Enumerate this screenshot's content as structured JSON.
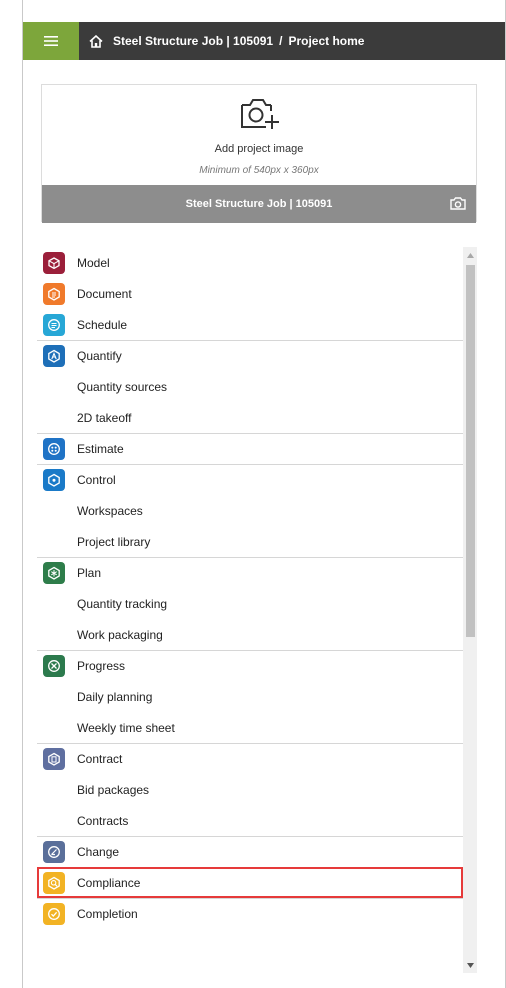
{
  "header": {
    "project": "Steel Structure Job | 105091",
    "separator": "/",
    "page": "Project home",
    "menu_icon": "hamburger-icon",
    "home_icon": "home-icon",
    "accent": "#7da63b",
    "bar_color": "#3b3b3b"
  },
  "card": {
    "add_label": "Add project image",
    "min_size": "Minimum of 540px x 360px",
    "project_name": "Steel Structure Job | 105091",
    "camera_icon": "camera-plus-icon"
  },
  "nav": [
    {
      "label": "Model",
      "type": "head",
      "icon": "model-icon",
      "color": "#9b1f3a"
    },
    {
      "label": "Document",
      "type": "head",
      "icon": "document-icon",
      "color": "#f07a2b"
    },
    {
      "label": "Schedule",
      "type": "head",
      "icon": "schedule-icon",
      "color": "#27a7d6"
    },
    {
      "label": "Quantify",
      "type": "head",
      "icon": "quantify-icon",
      "color": "#1e6fb8"
    },
    {
      "label": "Quantity sources",
      "type": "sub"
    },
    {
      "label": "2D takeoff",
      "type": "sub"
    },
    {
      "label": "Estimate",
      "type": "head",
      "icon": "estimate-icon",
      "color": "#1f73c6"
    },
    {
      "label": "Control",
      "type": "head",
      "icon": "control-icon",
      "color": "#1a7ac8"
    },
    {
      "label": "Workspaces",
      "type": "sub"
    },
    {
      "label": "Project library",
      "type": "sub"
    },
    {
      "label": "Plan",
      "type": "head",
      "icon": "plan-icon",
      "color": "#2e7d4a"
    },
    {
      "label": "Quantity tracking",
      "type": "sub"
    },
    {
      "label": "Work packaging",
      "type": "sub"
    },
    {
      "label": "Progress",
      "type": "head",
      "icon": "progress-icon",
      "color": "#2c7a4d"
    },
    {
      "label": "Daily planning",
      "type": "sub"
    },
    {
      "label": "Weekly time sheet",
      "type": "sub"
    },
    {
      "label": "Contract",
      "type": "head",
      "icon": "contract-icon",
      "color": "#5f6fa0"
    },
    {
      "label": "Bid packages",
      "type": "sub"
    },
    {
      "label": "Contracts",
      "type": "sub"
    },
    {
      "label": "Change",
      "type": "head",
      "icon": "change-icon",
      "color": "#5a6f9a"
    },
    {
      "label": "Compliance",
      "type": "head",
      "icon": "compliance-icon",
      "color": "#f2b324",
      "highlighted": true
    },
    {
      "label": "Completion",
      "type": "head",
      "icon": "completion-icon",
      "color": "#f2b324"
    }
  ]
}
